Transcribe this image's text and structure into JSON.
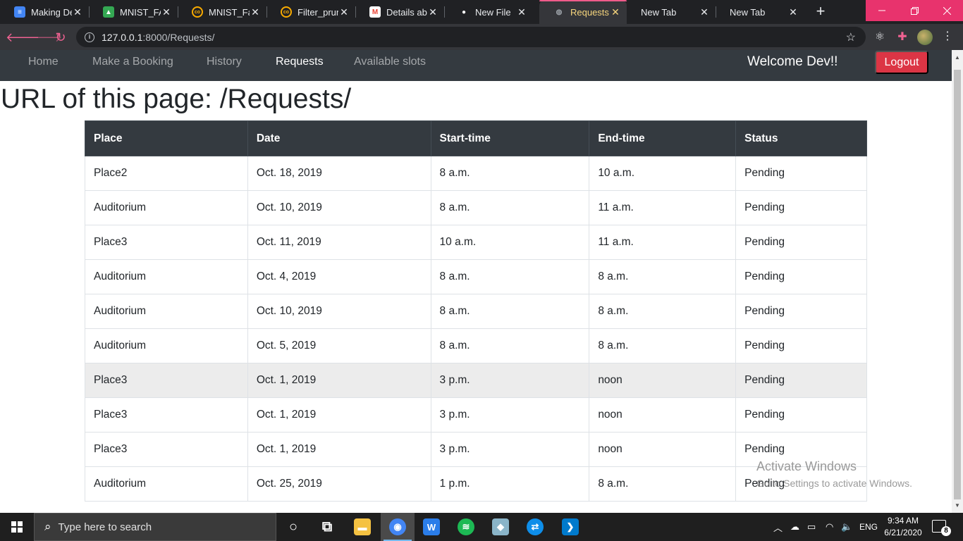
{
  "browser": {
    "tabs": [
      {
        "title": "Making Dec",
        "favicon": "google-docs-icon",
        "color": "#4285f4",
        "glyph": "≡"
      },
      {
        "title": "MNIST_FASI",
        "favicon": "google-drive-icon",
        "color": "#34a853",
        "glyph": "▲"
      },
      {
        "title": "MNIST_Fasl",
        "favicon": "colab-icon",
        "color": "#f9ab00",
        "glyph": "co"
      },
      {
        "title": "Filter_prunir",
        "favicon": "colab-icon",
        "color": "#f9ab00",
        "glyph": "co"
      },
      {
        "title": "Details abo",
        "favicon": "gmail-icon",
        "color": "#ea4335",
        "glyph": "M"
      },
      {
        "title": "New File",
        "favicon": "github-icon",
        "color": "#ffffff",
        "glyph": "●"
      },
      {
        "title": "Requests",
        "favicon": "globe-icon",
        "color": "#9aa0a6",
        "glyph": "◍"
      },
      {
        "title": "New Tab",
        "favicon": "",
        "color": "",
        "glyph": ""
      },
      {
        "title": "New Tab",
        "favicon": "",
        "color": "",
        "glyph": ""
      }
    ],
    "active_tab": 6,
    "url_host": "127.0.0.1",
    "url_path": ":8000/Requests/"
  },
  "site": {
    "nav": [
      "Home",
      "Make a Booking",
      "History",
      "Requests",
      "Available slots"
    ],
    "active_nav": "Requests",
    "welcome": "Welcome Dev!!",
    "logout": "Logout",
    "page_title": "URL of this page: /Requests/"
  },
  "table": {
    "headers": [
      "Place",
      "Date",
      "Start-time",
      "End-time",
      "Status"
    ],
    "rows": [
      [
        "Place2",
        "Oct. 18, 2019",
        "8 a.m.",
        "10 a.m.",
        "Pending"
      ],
      [
        "Auditorium",
        "Oct. 10, 2019",
        "8 a.m.",
        "11 a.m.",
        "Pending"
      ],
      [
        "Place3",
        "Oct. 11, 2019",
        "10 a.m.",
        "11 a.m.",
        "Pending"
      ],
      [
        "Auditorium",
        "Oct. 4, 2019",
        "8 a.m.",
        "8 a.m.",
        "Pending"
      ],
      [
        "Auditorium",
        "Oct. 10, 2019",
        "8 a.m.",
        "8 a.m.",
        "Pending"
      ],
      [
        "Auditorium",
        "Oct. 5, 2019",
        "8 a.m.",
        "8 a.m.",
        "Pending"
      ],
      [
        "Place3",
        "Oct. 1, 2019",
        "3 p.m.",
        "noon",
        "Pending"
      ],
      [
        "Place3",
        "Oct. 1, 2019",
        "3 p.m.",
        "noon",
        "Pending"
      ],
      [
        "Place3",
        "Oct. 1, 2019",
        "3 p.m.",
        "noon",
        "Pending"
      ],
      [
        "Auditorium",
        "Oct. 25, 2019",
        "1 p.m.",
        "8 a.m.",
        "Pending"
      ]
    ],
    "hovered_row": 6
  },
  "watermark": {
    "line1": "Activate Windows",
    "line2": "Go to Settings to activate Windows."
  },
  "taskbar": {
    "search_placeholder": "Type here to search",
    "apps": [
      {
        "name": "cortana-icon",
        "color": "",
        "glyph": "○"
      },
      {
        "name": "task-view-icon",
        "color": "",
        "glyph": "⧉"
      },
      {
        "name": "file-explorer-icon",
        "color": "#f5c242",
        "glyph": "▬"
      },
      {
        "name": "chrome-icon",
        "color": "#4285f4",
        "glyph": "◉"
      },
      {
        "name": "wps-writer-icon",
        "color": "#2b7de9",
        "glyph": "W"
      },
      {
        "name": "spotify-icon",
        "color": "#1db954",
        "glyph": "≋"
      },
      {
        "name": "notes-app-icon",
        "color": "#8ab4c8",
        "glyph": "◆"
      },
      {
        "name": "teamviewer-icon",
        "color": "#0e8ee9",
        "glyph": "⇄"
      },
      {
        "name": "vscode-icon",
        "color": "#007acc",
        "glyph": "❯"
      }
    ],
    "active_app": 3,
    "language": "ENG",
    "time": "9:34 AM",
    "date": "6/21/2020",
    "notification_count": "8"
  }
}
